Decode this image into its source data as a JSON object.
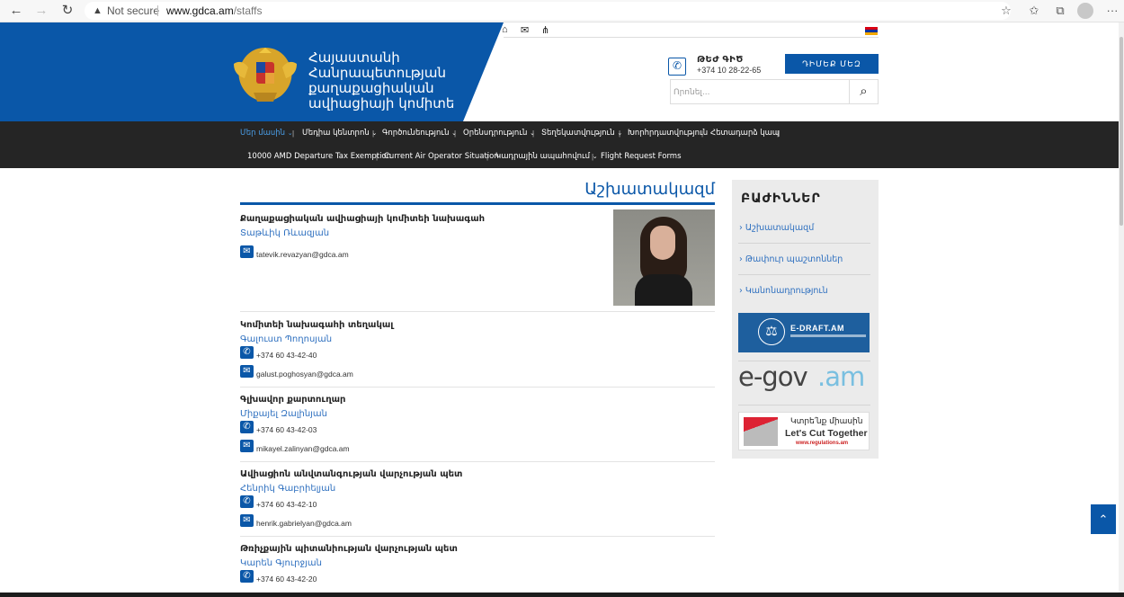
{
  "browser": {
    "security_label": "Not secure",
    "url_host": "www.gdca.am",
    "url_path": "/staffs",
    "icons": [
      "back-arrow-icon",
      "forward-arrow-icon",
      "reload-icon",
      "warning-icon",
      "favorite-icon",
      "collections-icon",
      "tabs-icon",
      "profile-icon",
      "menu-icon"
    ]
  },
  "header": {
    "brand_lines": [
      "Հայաստանի",
      "Հանրապետության",
      "քաղաքացիական",
      "ավիացիայի կոմիտե"
    ],
    "hotline_label": "ԹԵԺ ԳԻԾ",
    "hotline_number": "+374 10 28-22-65",
    "contact_button": "ԴԻՄԵՔ ՄԵԶ",
    "search_placeholder": "Որոնել...",
    "top_icons": [
      "home-icon",
      "mail-icon",
      "sitemap-icon"
    ],
    "brand_color": "#0a57a8"
  },
  "nav": {
    "row1": [
      {
        "label": "Մեր մասին",
        "dropdown": true,
        "active": true
      },
      {
        "label": "Մեդիա կենտրոն",
        "dropdown": true
      },
      {
        "label": "Գործունեություն",
        "dropdown": true
      },
      {
        "label": "Օրենսդրություն",
        "dropdown": true
      },
      {
        "label": "Տեղեկատվություն",
        "dropdown": true
      },
      {
        "label": "Խորհրդատվություն",
        "dropdown": false
      },
      {
        "label": "Հետադարձ կապ",
        "dropdown": false
      }
    ],
    "row2": [
      {
        "label": "10000 AMD Departure Tax Exemption",
        "dropdown": false
      },
      {
        "label": "Current Air Operator Situation",
        "dropdown": false
      },
      {
        "label": "Կադրային ապահովում",
        "dropdown": true
      },
      {
        "label": "Flight Request Forms",
        "dropdown": false
      }
    ]
  },
  "main": {
    "title": "Աշխատակազմ",
    "staff": [
      {
        "position": "Քաղաքացիական ավիացիայի կոմիտեի նախագահ",
        "name": "Տաթևիկ Ռևազյան",
        "phone": "",
        "email": "tatevik.revazyan@gdca.am"
      },
      {
        "position": "Կոմիտեի նախագահի տեղակալ",
        "name": "Գալուստ Պողոսյան",
        "phone": "+374 60 43-42-40",
        "email": "galust.poghosyan@gdca.am"
      },
      {
        "position": "Գլխավոր քարտուղար",
        "name": "Միքայել Զալինյան",
        "phone": "+374 60 43-42-03",
        "email": "mikayel.zalinyan@gdca.am"
      },
      {
        "position": "Ավիացիոն անվտանգության վարչության պետ",
        "name": "Հենրիկ Գաբրիելյան",
        "phone": "+374 60 43-42-10",
        "email": "henrik.gabrielyan@gdca.am"
      },
      {
        "position": "Թռիչքային պիտանիության վարչության պետ",
        "name": "Կարեն Գյուրջյան",
        "phone": "+374 60 43-42-20",
        "email": ""
      }
    ]
  },
  "sidebar": {
    "title": "ԲԱԺԻՆՆԵՐ",
    "links": [
      "Աշխատակազմ",
      "Թափուր պաշտոններ",
      "Կանոնադրություն"
    ],
    "banners": {
      "edraft": "E-DRAFT.AM",
      "egov_a": "e-gov",
      "egov_b": ".am",
      "cut_arm": "Կտրե՛նք միասին",
      "cut_en": "Let's Cut Together",
      "cut_url": "www.regulations.am"
    }
  }
}
